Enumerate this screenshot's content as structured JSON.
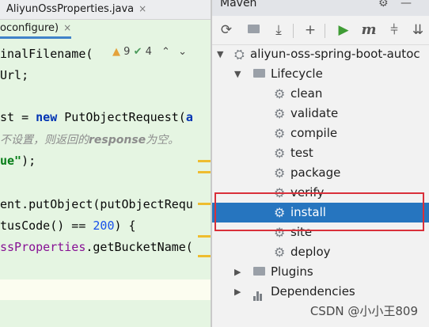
{
  "editor": {
    "tabs": [
      {
        "label": "AliyunOssProperties.java",
        "close": "×"
      },
      {
        "label": "oconfigure)",
        "close": "×"
      }
    ],
    "inspections": {
      "warnings": "9",
      "checks": "4"
    },
    "lines": {
      "l1": "inalFilename(",
      "l2": "Url;",
      "l4a": "st = ",
      "l4b": "new",
      "l4c": " PutObjectRequest(",
      "l4d": "a",
      "l5a": "不设置，则返回的",
      "l5b": "response",
      "l5c": "为空。",
      "l6a": "ue\"",
      "l6b": ");",
      "l8": "ent.putObject(putObjectRequ",
      "l9a": "tusCode() == ",
      "l9b": "200",
      "l9c": ") {",
      "l10a": "ssProperties",
      "l10b": ".getBucketName("
    }
  },
  "maven": {
    "title": "Maven",
    "toolbar": {
      "reload": "⟳",
      "generate": "⇓",
      "download": "⤓",
      "add": "+",
      "run": "▶",
      "execute": "m",
      "skip_tests": "⫩"
    },
    "tree": {
      "project": "aliyun-oss-spring-boot-autoc",
      "lifecycle": "Lifecycle",
      "goals": [
        "clean",
        "validate",
        "compile",
        "test",
        "package",
        "verify",
        "install",
        "site",
        "deploy"
      ],
      "selected_goal": "install",
      "plugins": "Plugins",
      "dependencies": "Dependencies"
    }
  },
  "watermark": "CSDN @小小王809",
  "colors": {
    "selection": "#2675bf",
    "highlight_box": "#d9303a",
    "editor_bg": "#e5f5e2"
  }
}
